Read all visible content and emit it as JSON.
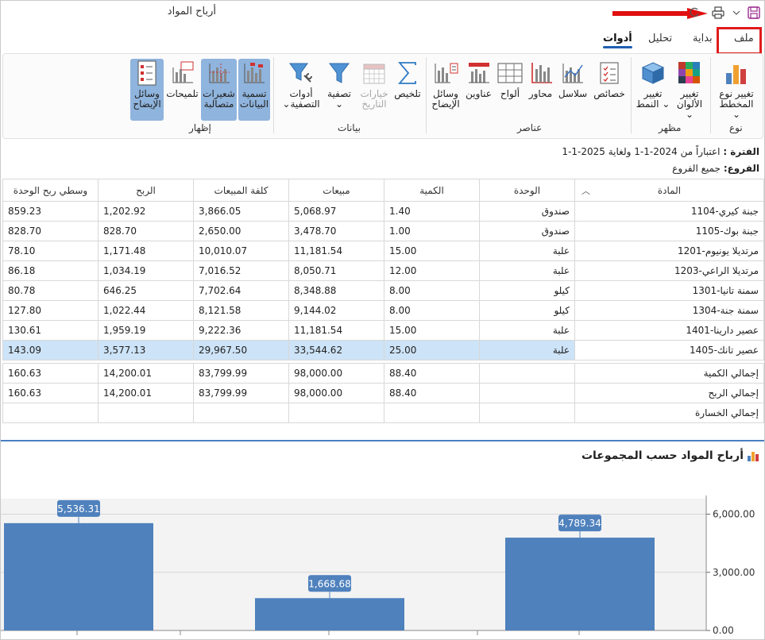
{
  "window": {
    "title": "أرباح المواد"
  },
  "tabs": [
    {
      "label": "ملف"
    },
    {
      "label": "بداية"
    },
    {
      "label": "تحليل"
    },
    {
      "label": "أدوات",
      "active": true
    }
  ],
  "ribbon": {
    "groups": [
      {
        "label": "نوع",
        "buttons": [
          {
            "label": "تغيير نوع",
            "label2": "المخطط",
            "dropdown": true,
            "icon": "chart-type-icon"
          }
        ]
      },
      {
        "label": "مظهر",
        "buttons": [
          {
            "label": "تغيير",
            "label2": "الألوان",
            "dropdown": true,
            "icon": "palette-icon"
          },
          {
            "label": "تغيير",
            "label2": "النمط",
            "dropdown": true,
            "icon": "cube-icon"
          }
        ]
      },
      {
        "label": "عناصر",
        "buttons": [
          {
            "label": "خصائص",
            "icon": "properties-icon"
          },
          {
            "label": "سلاسل",
            "icon": "series-icon"
          },
          {
            "label": "محاور",
            "icon": "axes-icon"
          },
          {
            "label": "ألواح",
            "icon": "panes-icon"
          },
          {
            "label": "عناوين",
            "icon": "titles-icon"
          },
          {
            "label": "وسائل",
            "label2": "الإيضاح",
            "icon": "legend-icon"
          }
        ]
      },
      {
        "label": "بيانات",
        "buttons": [
          {
            "label": "تلخيص",
            "icon": "sigma-icon"
          },
          {
            "label": "خيارات",
            "label2": "التاريخ",
            "disabled": true,
            "icon": "calendar-icon"
          },
          {
            "label": "تصفية",
            "dropdown": true,
            "icon": "filter-icon"
          },
          {
            "label": "أدوات",
            "label2": "التصفية",
            "dropdown": true,
            "icon": "filter-tools-icon"
          }
        ]
      },
      {
        "label": "إظهار",
        "buttons": [
          {
            "label": "تسمية",
            "label2": "البيانات",
            "active": true,
            "icon": "data-labels-icon"
          },
          {
            "label": "شعيرات",
            "label2": "متصالبة",
            "active": true,
            "icon": "crosshair-icon"
          },
          {
            "label": "تلميحات",
            "icon": "tooltip-icon"
          },
          {
            "label": "وسائل",
            "label2": "الإيضاح",
            "active": true,
            "icon": "show-legend-icon"
          }
        ]
      }
    ]
  },
  "info": {
    "period_label": "الفترة :",
    "period_value": "اعتباراً من 2024-1-1 ولغاية 2025-1-1",
    "branches_label": "الفروع:",
    "branches_value": "جميع الفروع"
  },
  "table": {
    "columns": [
      "المادة",
      "الوحدة",
      "الكمية",
      "مبيعات",
      "كلفة المبيعات",
      "الربح",
      "وسطي ربح الوحدة"
    ],
    "rows": [
      [
        "1104-جبنة كيري",
        "صندوق",
        "1.40",
        "5,068.97",
        "3,866.05",
        "1,202.92",
        "859.23"
      ],
      [
        "1105-جبنة بوك",
        "صندوق",
        "1.00",
        "3,478.70",
        "2,650.00",
        "828.70",
        "828.70"
      ],
      [
        "1201-مرتديلا يونيوم",
        "علبة",
        "15.00",
        "11,181.54",
        "10,010.07",
        "1,171.48",
        "78.10"
      ],
      [
        "1203-مرتديلا الراعي",
        "علبة",
        "12.00",
        "8,050.71",
        "7,016.52",
        "1,034.19",
        "86.18"
      ],
      [
        "1301-سمنة تانيا",
        "كيلو",
        "8.00",
        "8,348.88",
        "7,702.64",
        "646.25",
        "80.78"
      ],
      [
        "1304-سمنة جنة",
        "كيلو",
        "8.00",
        "9,144.02",
        "8,121.58",
        "1,022.44",
        "127.80"
      ],
      [
        "1401-عصير دارينا",
        "علبة",
        "15.00",
        "11,181.54",
        "9,222.36",
        "1,959.19",
        "130.61"
      ],
      [
        "1405-عصير تانك",
        "علبة",
        "25.00",
        "33,544.62",
        "29,967.50",
        "3,577.13",
        "143.09"
      ]
    ],
    "totals": [
      [
        "إجمالي الكمية",
        "",
        "88.40",
        "98,000.00",
        "83,799.99",
        "14,200.01",
        "160.63"
      ],
      [
        "إجمالي الربح",
        "",
        "88.40",
        "98,000.00",
        "83,799.99",
        "14,200.01",
        "160.63"
      ],
      [
        "إجمالي الخسارة",
        "",
        "",
        "",
        "",
        "",
        ""
      ]
    ]
  },
  "chart_panel": {
    "title": "أرباح المواد حسب المجموعات"
  },
  "chart_data": {
    "type": "bar",
    "title": "أرباح المواد حسب المجموعات",
    "values": [
      5536.31,
      1668.68,
      4789.34
    ],
    "data_labels": [
      "5,536.31",
      "1,668.68",
      "4,789.34"
    ],
    "y_ticks": [
      "0.00",
      "3,000.00",
      "6,000.00"
    ],
    "ylim": [
      0,
      6800
    ],
    "y_axis_side": "right",
    "bar_color": "#4f81bd",
    "grid": true
  }
}
